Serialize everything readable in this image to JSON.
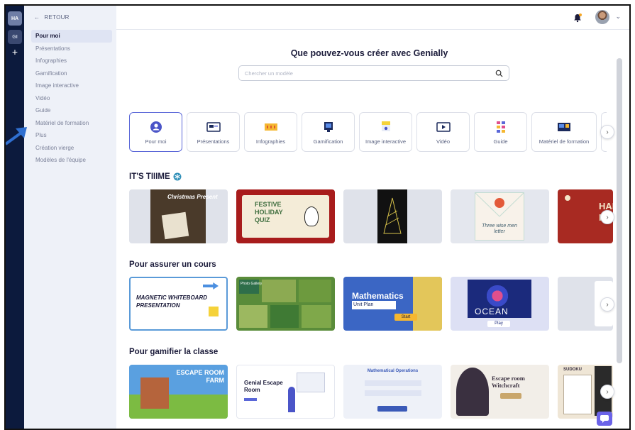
{
  "rail": {
    "workspaces": [
      "HA",
      "GI"
    ],
    "add_label": "+"
  },
  "sidebar": {
    "back_label": "RETOUR",
    "items": [
      {
        "label": "Pour moi",
        "active": true
      },
      {
        "label": "Présentations"
      },
      {
        "label": "Infographies"
      },
      {
        "label": "Gamification"
      },
      {
        "label": "Image interactive"
      },
      {
        "label": "Vidéo"
      },
      {
        "label": "Guide"
      },
      {
        "label": "Matériel de formation"
      },
      {
        "label": "Plus"
      },
      {
        "label": "Création vierge"
      },
      {
        "label": "Modèles de l'équipe"
      }
    ]
  },
  "main": {
    "headline": "Que pouvez-vous créer avec Genially",
    "search": {
      "placeholder": "Chercher un modèle",
      "value": ""
    },
    "categories": [
      {
        "label": "Pour moi",
        "icon": "user-icon",
        "active": true
      },
      {
        "label": "Présentations",
        "icon": "presentation-icon"
      },
      {
        "label": "Infographies",
        "icon": "infographic-icon"
      },
      {
        "label": "Gamification",
        "icon": "gamification-icon"
      },
      {
        "label": "Image interactive",
        "icon": "interactive-image-icon"
      },
      {
        "label": "Vidéo",
        "icon": "video-icon"
      },
      {
        "label": "Guide",
        "icon": "guide-icon"
      },
      {
        "label": "Matériel de formation",
        "icon": "training-material-icon"
      }
    ],
    "sections": [
      {
        "title": "IT'S TIIIME",
        "title_icon": "snowflake-icon",
        "thumbs": [
          {
            "text": "Christmas Present"
          },
          {
            "text": "FESTIVE HOLIDAY QUIZ"
          },
          {
            "text": ""
          },
          {
            "text": "Three wise men letter"
          },
          {
            "text": "HAP HO"
          }
        ]
      },
      {
        "title": "Pour assurer un cours",
        "thumbs": [
          {
            "text": "MAGNETIC WHITEBOARD PRESENTATION"
          },
          {
            "text": "Photo Gallery"
          },
          {
            "text": "Mathematics",
            "sub": "Unit Plan",
            "btn": "Start"
          },
          {
            "text": "OCEAN",
            "btn": "Play"
          },
          {
            "text": ""
          }
        ]
      },
      {
        "title": "Pour gamifier la classe",
        "thumbs": [
          {
            "text": "ESCAPE ROOM FARM"
          },
          {
            "text": "Genial Escape Room"
          },
          {
            "text": "Mathematical Operations"
          },
          {
            "text": "Escape room Witchcraft"
          },
          {
            "text": "SUDOKU"
          }
        ]
      }
    ]
  },
  "colors": {
    "rail": "#0c1a3d",
    "sidebar": "#eef1f8",
    "accent": "#5a67d8",
    "chat": "#6b63e8"
  }
}
